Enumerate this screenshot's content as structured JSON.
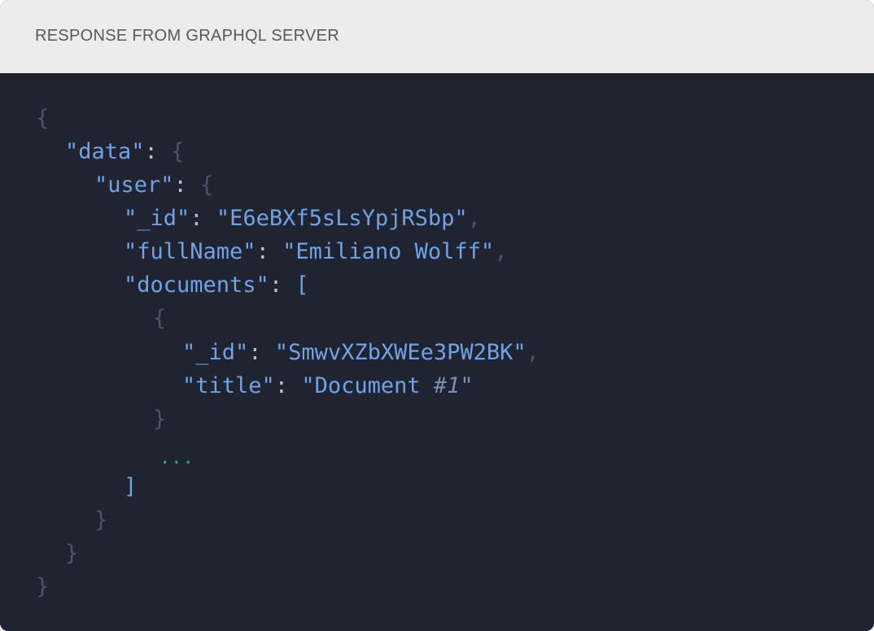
{
  "header": {
    "title": "RESPONSE FROM GRAPHQL SERVER"
  },
  "code": {
    "open_brace": "{",
    "close_brace": "}",
    "open_bracket": "[",
    "close_bracket": "]",
    "colon": ":",
    "comma": ",",
    "data_key": "\"data\"",
    "user_key": "\"user\"",
    "id_key": "\"_id\"",
    "user_id_value": "\"E6eBXf5sLsYpjRSbp\"",
    "fullname_key": "\"fullName\"",
    "fullname_value": "\"Emiliano Wolff\"",
    "documents_key": "\"documents\"",
    "doc_id_value": "\"SmwvXZbXWEe3PW2BK\"",
    "title_key": "\"title\"",
    "title_value_prefix": "\"Document ",
    "title_value_italic": "#1",
    "title_value_suffix": "\"",
    "ellipsis": "..."
  }
}
